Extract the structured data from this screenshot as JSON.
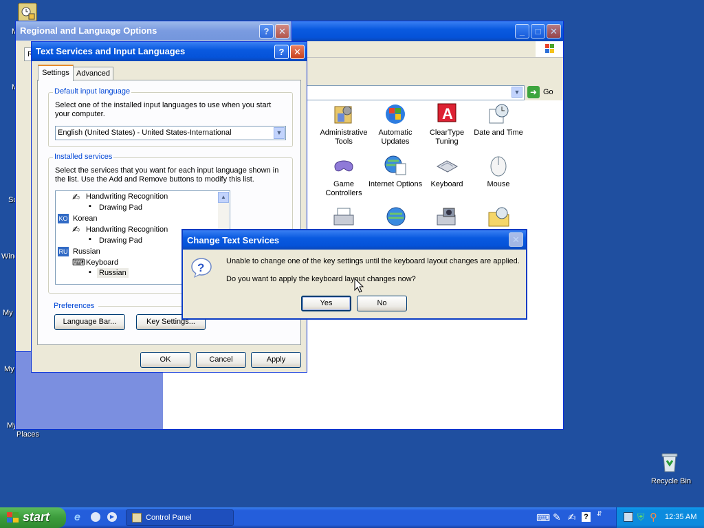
{
  "desktop": {
    "labels": [
      "M",
      "M",
      "Su",
      "Wind",
      "My I",
      "My",
      "My",
      "Places"
    ],
    "recycle_bin": "Recycle Bin"
  },
  "control_panel": {
    "go_label": "Go",
    "icons": [
      {
        "label": "Administrative Tools"
      },
      {
        "label": "Automatic Updates"
      },
      {
        "label": "ClearType Tuning"
      },
      {
        "label": "Date and Time"
      },
      {
        "label": "Game Controllers"
      },
      {
        "label": "Internet Options"
      },
      {
        "label": "Keyboard"
      },
      {
        "label": "Mouse"
      }
    ]
  },
  "regional": {
    "title": "Regional and Language Options",
    "help": "?",
    "close": "✕",
    "tab_hint": "R"
  },
  "tsil": {
    "title": "Text Services and Input Languages",
    "help": "?",
    "close": "✕",
    "tabs": [
      "Settings",
      "Advanced"
    ],
    "default_group": {
      "label": "Default input language",
      "description": "Select one of the installed input languages to use when you start your computer.",
      "selected": "English (United States) - United States-International"
    },
    "installed_group": {
      "label": "Installed services",
      "description": "Select the services that you want for each input language shown in the list. Use the Add and Remove buttons to modify this list."
    },
    "tree": [
      {
        "text": "Handwriting Recognition"
      },
      {
        "text": "Drawing Pad"
      },
      {
        "code": "KO",
        "text": "Korean"
      },
      {
        "text": "Handwriting Recognition"
      },
      {
        "text": "Drawing Pad"
      },
      {
        "code": "RU",
        "text": "Russian"
      },
      {
        "text": "Keyboard"
      },
      {
        "text": "Russian"
      }
    ],
    "preferences": {
      "label": "Preferences",
      "language_bar": "Language Bar...",
      "key_settings": "Key Settings..."
    },
    "ok": "OK",
    "cancel": "Cancel",
    "apply": "Apply"
  },
  "dialog": {
    "title": "Change Text Services",
    "close": "✕",
    "line1": "Unable to change one of the key settings until the keyboard layout changes are applied.",
    "line2": "Do you want to apply the keyboard layout changes now?",
    "yes": "Yes",
    "no": "No"
  },
  "taskbar": {
    "start": "start",
    "task": "Control Panel",
    "clock": "12:35 AM",
    "help_icon": "?"
  }
}
